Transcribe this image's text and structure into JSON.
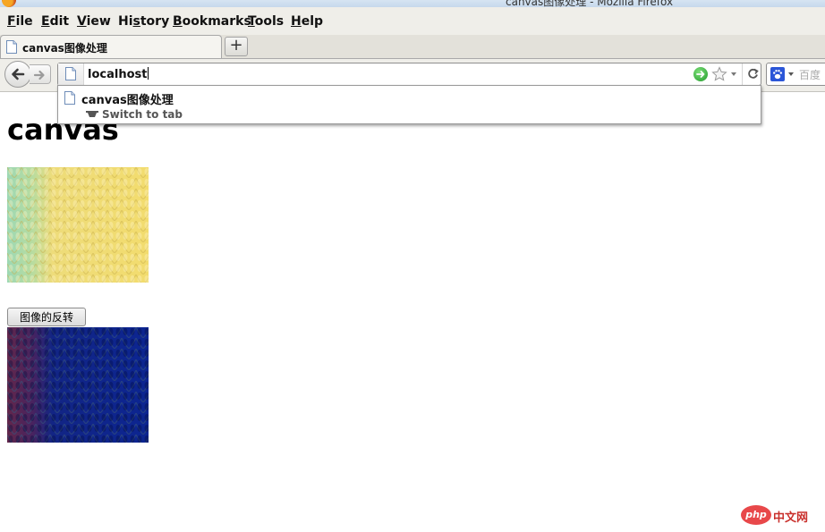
{
  "window": {
    "title": "canvas图像处理 - Mozilla Firefox"
  },
  "menu": {
    "items": [
      {
        "label": "File",
        "accel": "F",
        "rest": "ile"
      },
      {
        "label": "Edit",
        "accel": "E",
        "rest": "dit"
      },
      {
        "label": "View",
        "accel": "V",
        "rest": "iew"
      },
      {
        "label": "History",
        "accel": "s",
        "pre": "Hi",
        "rest": "tory"
      },
      {
        "label": "Bookmarks",
        "accel": "B",
        "rest": "ookmarks"
      },
      {
        "label": "Tools",
        "accel": "T",
        "rest": "ools"
      },
      {
        "label": "Help",
        "accel": "H",
        "rest": "elp"
      }
    ]
  },
  "tabs": [
    {
      "label": "canvas图像处理"
    }
  ],
  "newtab_label": "+",
  "urlbar": {
    "value": "localhost"
  },
  "searchbar": {
    "placeholder": "百度"
  },
  "autocomplete": {
    "title": "canvas图像处理",
    "action": "Switch to tab"
  },
  "page": {
    "heading": "canvas",
    "invert_button": "图像的反转"
  },
  "watermark": {
    "logo": "php",
    "text": "中文网"
  },
  "colors": {
    "yarn_yellow": "#f2dc6e",
    "yarn_mint": "#9dd8b4",
    "inverted_blue": "#0c2591",
    "inverted_red": "#62274b"
  }
}
